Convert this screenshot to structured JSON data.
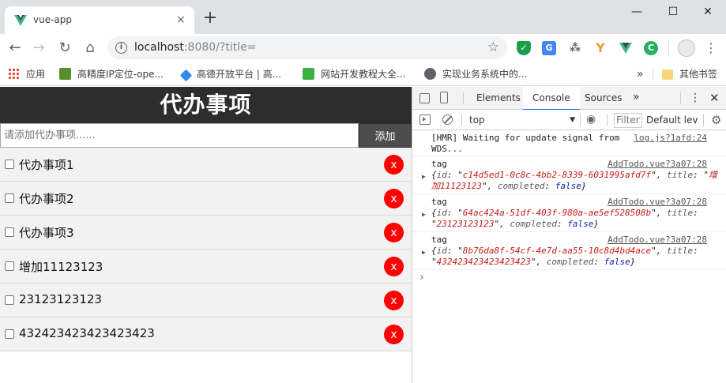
{
  "browser": {
    "tab_title": "vue-app",
    "tab_close": "×",
    "new_tab": "+",
    "window": {
      "minimize": "—",
      "maximize": "☐",
      "close": "✕"
    },
    "url_host": "localhost",
    "url_rest": ":8080/?title=",
    "bookmarks": {
      "apps": "应用",
      "items": [
        "高精度IP定位-ope...",
        "高德开放平台 | 高...",
        "网站开发教程大全...",
        "实现业务系统中的..."
      ],
      "more": "»",
      "other": "其他书签"
    },
    "brand_color": "#42b883"
  },
  "app": {
    "title": "代办事项",
    "input_placeholder": "请添加代办事项......",
    "add_label": "添加",
    "delete_label": "x",
    "todos": [
      {
        "title": "代办事项1",
        "completed": false
      },
      {
        "title": "代办事项2",
        "completed": false
      },
      {
        "title": "代办事项3",
        "completed": false
      },
      {
        "title": "增加11123123",
        "completed": false
      },
      {
        "title": "23123123123",
        "completed": false
      },
      {
        "title": "432423423423423423",
        "completed": false
      }
    ]
  },
  "devtools": {
    "tabs": [
      "Elements",
      "Console",
      "Sources"
    ],
    "active_tab": "Console",
    "more": "»",
    "context": "top",
    "filter_placeholder": "Filter",
    "levels": "Default levels",
    "messages": [
      {
        "type": "hmr",
        "text": "[HMR] Waiting for update signal from WDS...",
        "source": "log.js?1afd:24"
      },
      {
        "type": "log",
        "label": "tag",
        "source": "AddTodo.vue?3a07:28",
        "id": "c14d5ed1-0c8c-4bb2-8339-6031995afd7f",
        "title": "增加11123123",
        "completed": "false"
      },
      {
        "type": "log",
        "label": "tag",
        "source": "AddTodo.vue?3a07:28",
        "id": "64ac424a-51df-403f-980a-ae5ef528508b",
        "title": "23123123123",
        "completed": "false"
      },
      {
        "type": "log",
        "label": "tag",
        "source": "AddTodo.vue?3a07:28",
        "id": "8b76da8f-54cf-4e7d-aa55-10c8d4bd4ace",
        "title": "432423423423423423",
        "completed": "false"
      }
    ],
    "prompt": "›"
  }
}
